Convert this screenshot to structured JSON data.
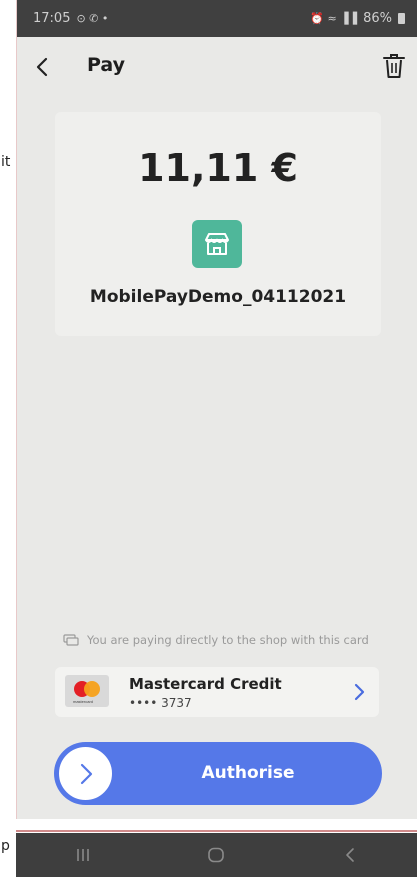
{
  "edge": {
    "top_text": "it",
    "bottom_text": "p"
  },
  "status_bar": {
    "time": "17:05",
    "left_icons": "⊙ ✆ •",
    "right_icons": "⏰ ≈ ▐▐",
    "battery": "86%"
  },
  "header": {
    "title": "Pay",
    "back_icon": "chevron-left-icon",
    "trash_icon": "trash-icon"
  },
  "payment": {
    "amount": "11,11 €",
    "merchant": "MobilePayDemo_04112021",
    "shop_icon": "store-icon",
    "shop_color": "#4fb79a"
  },
  "notice": {
    "text": "You are paying directly to the shop with this card",
    "icon": "cards-icon"
  },
  "card": {
    "brand_small": "mastercard",
    "name": "Mastercard Credit",
    "number": "•••• 3737"
  },
  "action": {
    "label": "Authorise",
    "color": "#5578e8"
  },
  "navbar": {
    "recent": "recent-apps-icon",
    "home": "home-icon",
    "back": "back-icon"
  }
}
